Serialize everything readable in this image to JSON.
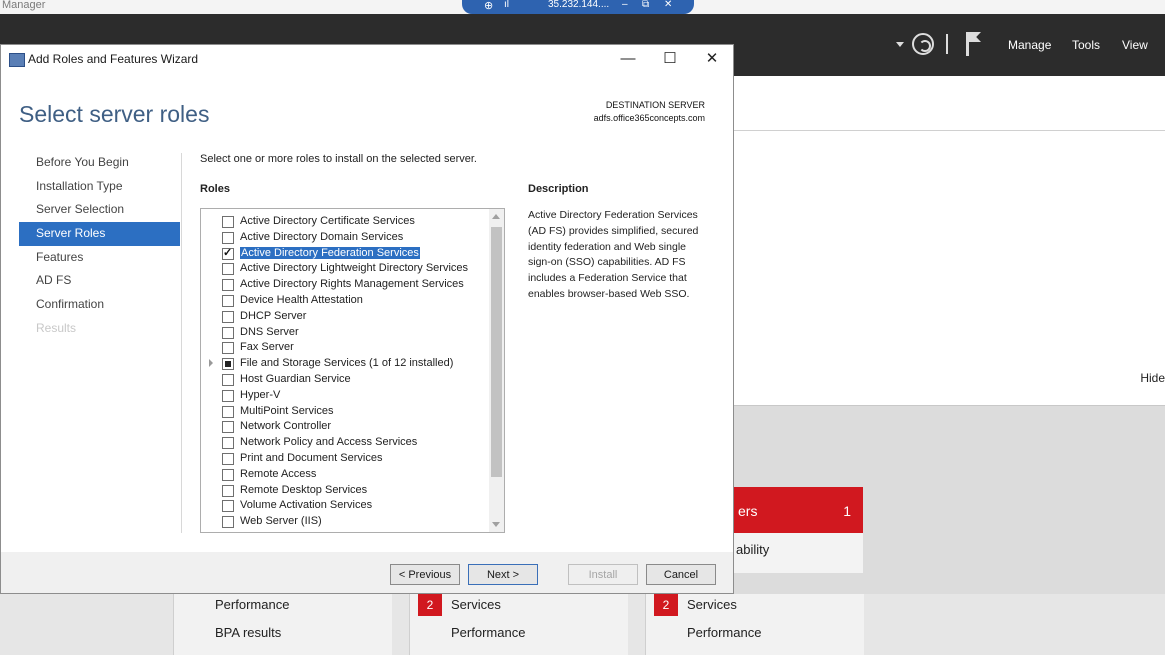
{
  "background": {
    "app_title": "Manager",
    "rdp_bar": {
      "address": "35.232.144....",
      "pin_glyph": "⊕",
      "signal_glyph": "ıl",
      "minimize_glyph": "–",
      "restore_glyph": "⧉",
      "close_glyph": "✕"
    },
    "menu": {
      "manage": "Manage",
      "tools": "Tools",
      "view": "View"
    },
    "hide_link": "Hide",
    "tile": {
      "label": "ers",
      "count": "1",
      "sub_label": "ability"
    },
    "columns": [
      {
        "rows": [
          "Performance",
          "BPA results"
        ]
      },
      {
        "badge": "2",
        "rows": [
          "Services",
          "Performance"
        ]
      },
      {
        "badge": "2",
        "rows": [
          "Services",
          "Performance"
        ]
      }
    ]
  },
  "wizard": {
    "window_title": "Add Roles and Features Wizard",
    "controls": {
      "minimize": "—",
      "maximize": "☐",
      "close": "✕"
    },
    "page_title": "Select server roles",
    "destination": {
      "label": "DESTINATION SERVER",
      "value": "adfs.office365concepts.com"
    },
    "nav": [
      {
        "label": "Before You Begin",
        "state": "normal"
      },
      {
        "label": "Installation Type",
        "state": "normal"
      },
      {
        "label": "Server Selection",
        "state": "normal"
      },
      {
        "label": "Server Roles",
        "state": "active"
      },
      {
        "label": "Features",
        "state": "normal"
      },
      {
        "label": "AD FS",
        "state": "normal"
      },
      {
        "label": "Confirmation",
        "state": "normal"
      },
      {
        "label": "Results",
        "state": "disabled"
      }
    ],
    "instruction": "Select one or more roles to install on the selected server.",
    "roles_heading": "Roles",
    "roles": [
      {
        "label": "Active Directory Certificate Services",
        "checked": false
      },
      {
        "label": "Active Directory Domain Services",
        "checked": false
      },
      {
        "label": "Active Directory Federation Services",
        "checked": true,
        "selected": true
      },
      {
        "label": "Active Directory Lightweight Directory Services",
        "checked": false
      },
      {
        "label": "Active Directory Rights Management Services",
        "checked": false
      },
      {
        "label": "Device Health Attestation",
        "checked": false
      },
      {
        "label": "DHCP Server",
        "checked": false
      },
      {
        "label": "DNS Server",
        "checked": false
      },
      {
        "label": "Fax Server",
        "checked": false
      },
      {
        "label": "File and Storage Services (1 of 12 installed)",
        "checked": "partial",
        "expandable": true
      },
      {
        "label": "Host Guardian Service",
        "checked": false
      },
      {
        "label": "Hyper-V",
        "checked": false
      },
      {
        "label": "MultiPoint Services",
        "checked": false
      },
      {
        "label": "Network Controller",
        "checked": false
      },
      {
        "label": "Network Policy and Access Services",
        "checked": false
      },
      {
        "label": "Print and Document Services",
        "checked": false
      },
      {
        "label": "Remote Access",
        "checked": false
      },
      {
        "label": "Remote Desktop Services",
        "checked": false
      },
      {
        "label": "Volume Activation Services",
        "checked": false
      },
      {
        "label": "Web Server (IIS)",
        "checked": false
      }
    ],
    "description_heading": "Description",
    "description": "Active Directory Federation Services (AD FS) provides simplified, secured identity federation and Web single sign-on (SSO) capabilities. AD FS includes a Federation Service that enables browser-based Web SSO.",
    "buttons": {
      "previous": "< Previous",
      "next": "Next >",
      "install": "Install",
      "cancel": "Cancel"
    }
  }
}
